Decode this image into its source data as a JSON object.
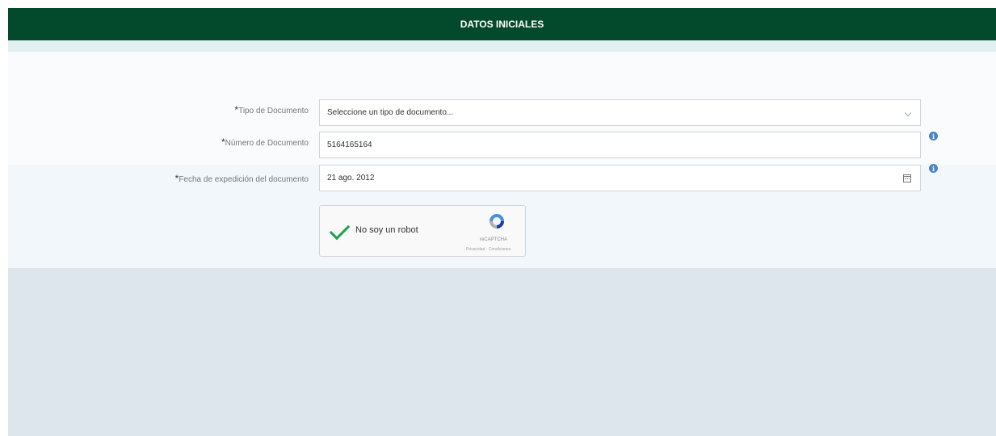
{
  "header": {
    "title": "DATOS INICIALES"
  },
  "form": {
    "tipo_documento": {
      "required_mark": "*",
      "label": "Tipo de Documento",
      "value": "Seleccione un tipo de documento..."
    },
    "numero_documento": {
      "required_mark": "*",
      "label": "Número de Documento",
      "value": "5164165164"
    },
    "fecha_expedicion": {
      "required_mark": "*",
      "label": "Fecha de expedición del documento",
      "value": "21 ago. 2012"
    }
  },
  "captcha": {
    "label": "No soy un robot",
    "brand": "reCAPTCHA",
    "terms": "Privacidad - Condiciones",
    "checked": true
  },
  "icons": {
    "info": "info-icon",
    "calendar": "calendar-icon",
    "chevron": "chevron-down-icon",
    "check": "checkmark-icon"
  },
  "colors": {
    "header_bg": "#034a2d",
    "info_blue": "#4a83c9",
    "check_green": "#1aa34a",
    "panel_bg": "#dde6ed"
  }
}
